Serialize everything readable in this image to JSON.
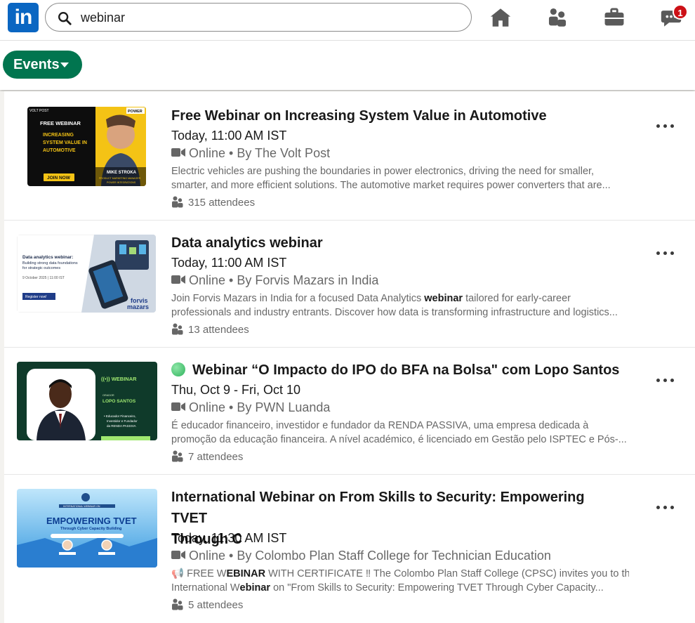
{
  "search": {
    "value": "webinar"
  },
  "header": {
    "logo_text": "in",
    "notification_count": "1"
  },
  "filter": {
    "events_label": "Events"
  },
  "results": [
    {
      "title": "Free Webinar on Increasing System Value in Automotive",
      "date": "Today, 11:00 AM IST",
      "host": "Online • By The Volt Post",
      "desc_line1": "Electric vehicles are pushing the boundaries in power electronics, driving the need for smaller,",
      "desc_line2": "smarter, and more efficient solutions. The automotive market requires power converters that are...",
      "attendees": "315 attendees",
      "thumb": {
        "logo_text": "VOLT POST",
        "corner_text": "POWER",
        "tag": "FREE WEBINAR",
        "headline1": "INCREASING",
        "headline2": "SYSTEM VALUE IN",
        "headline3": "AUTOMOTIVE",
        "cta": "JOIN NOW",
        "speaker": "MIKE STROKA",
        "speaker_role1": "PRODUCT MARKETING MANAGER",
        "speaker_role2": "POWER INTEGRATIONS"
      }
    },
    {
      "title": "Data analytics webinar",
      "date": "Today, 11:00 AM IST",
      "host": "Online • By Forvis Mazars in India",
      "desc_pre": "Join Forvis Mazars in India for a focused Data Analytics ",
      "desc_bold": "webinar",
      "desc_post": " tailored for early-career",
      "desc_line2": "professionals and industry entrants. Discover how data is transforming infrastructure and logistics...",
      "attendees": "13 attendees",
      "thumb": {
        "line1": "Data analytics webinar:",
        "line2": "Building strong data foundations",
        "line3": "for strategic outcomes",
        "date": "9 October 2025 | 11:00 IST",
        "cta": "Register now!",
        "brand1": "forvis",
        "brand2": "mazars"
      }
    },
    {
      "title": "Webinar “O Impacto do IPO do BFA na Bolsa\" com Lopo Santos",
      "date": "Thu, Oct 9 - Fri, Oct 10",
      "host": "Online • By PWN Luanda",
      "desc_line1": "É educador financeiro, investidor e fundador da RENDA PASSIVA, uma empresa dedicada à",
      "desc_line2": "promoção da educação financeira. A nível académico, é licenciado em Gestão pelo ISPTEC e Pós-...",
      "attendees": "7 attendees",
      "thumb": {
        "tag": "((•)) WEBINAR",
        "small": "ORADOR",
        "name": "LOPO SANTOS",
        "bullet1": "• Educador Financeiro,",
        "bullet2": "Investidor e Fundador",
        "bullet3": "da RENDA PASSIVA"
      }
    },
    {
      "title_line1": "International Webinar on From Skills to Security: Empowering TVET",
      "title_line2": "Through C",
      "date": "Today, 11:30 AM IST",
      "host": "Online • By Colombo Plan Staff College for Technician Education",
      "desc_pre": "📢 FREE W",
      "desc_bold1": "EBINAR",
      "desc_mid": " WITH CERTIFICATE ‼ The Colombo Plan Staff College (CPSC) invites you to the",
      "desc2_pre": "International W",
      "desc2_bold": "ebinar",
      "desc2_post": " on \"From Skills to Security: Empowering TVET Through Cyber Capacity...",
      "attendees": "5 attendees",
      "thumb": {
        "small": "INTERNATIONAL WEBINAR ON",
        "headline": "EMPOWERING TVET",
        "sub": "Through Cyber Capacity Building"
      }
    }
  ]
}
